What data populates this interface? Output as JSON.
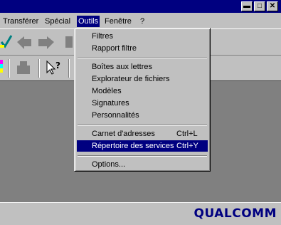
{
  "menubar": {
    "items": [
      {
        "label": "Transférer"
      },
      {
        "label": "Spécial"
      },
      {
        "label": "Outils"
      },
      {
        "label": "Fenêtre"
      },
      {
        "label": "?"
      }
    ]
  },
  "window_buttons": {
    "minimize": "▬",
    "maximize": "□",
    "close": "✕"
  },
  "menu": {
    "items": [
      {
        "label": "Filtres"
      },
      {
        "label": "Rapport filtre"
      },
      {
        "label": "Boîtes aux lettres"
      },
      {
        "label": "Explorateur de fichiers"
      },
      {
        "label": "Modèles"
      },
      {
        "label": "Signatures"
      },
      {
        "label": "Personnalités"
      },
      {
        "label": "Carnet d'adresses",
        "shortcut": "Ctrl+L"
      },
      {
        "label": "Répertoire des services",
        "shortcut": "Ctrl+Y"
      },
      {
        "label": "Options..."
      }
    ]
  },
  "brand": {
    "logo_text": "QUALCOMM"
  },
  "colors": {
    "titlebar": "#000080",
    "highlight": "#000080",
    "workspace": "#808080",
    "face": "#c0c0c0"
  }
}
